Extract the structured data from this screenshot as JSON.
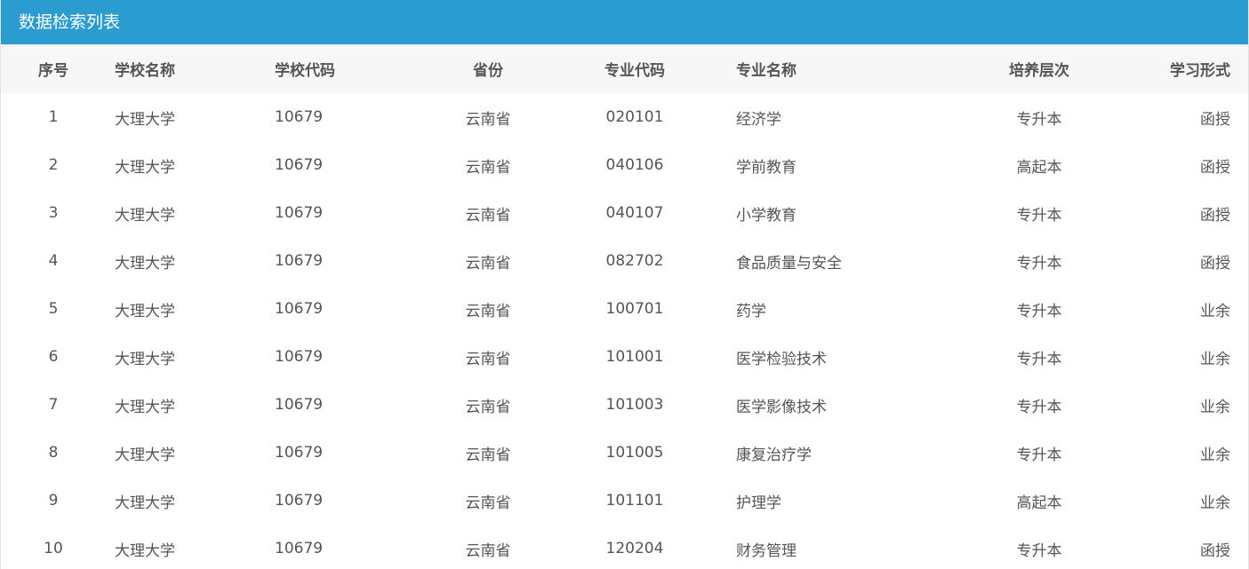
{
  "panel": {
    "title": "数据检索列表"
  },
  "colors": {
    "header_bg": "#2a9ccf",
    "header_text": "#ffffff",
    "thead_bg": "#f7f7f7",
    "text": "#555555"
  },
  "table": {
    "headers": [
      "序号",
      "学校名称",
      "学校代码",
      "省份",
      "专业代码",
      "专业名称",
      "培养层次",
      "学习形式"
    ],
    "rows": [
      [
        "1",
        "大理大学",
        "10679",
        "云南省",
        "020101",
        "经济学",
        "专升本",
        "函授"
      ],
      [
        "2",
        "大理大学",
        "10679",
        "云南省",
        "040106",
        "学前教育",
        "高起本",
        "函授"
      ],
      [
        "3",
        "大理大学",
        "10679",
        "云南省",
        "040107",
        "小学教育",
        "专升本",
        "函授"
      ],
      [
        "4",
        "大理大学",
        "10679",
        "云南省",
        "082702",
        "食品质量与安全",
        "专升本",
        "函授"
      ],
      [
        "5",
        "大理大学",
        "10679",
        "云南省",
        "100701",
        "药学",
        "专升本",
        "业余"
      ],
      [
        "6",
        "大理大学",
        "10679",
        "云南省",
        "101001",
        "医学检验技术",
        "专升本",
        "业余"
      ],
      [
        "7",
        "大理大学",
        "10679",
        "云南省",
        "101003",
        "医学影像技术",
        "专升本",
        "业余"
      ],
      [
        "8",
        "大理大学",
        "10679",
        "云南省",
        "101005",
        "康复治疗学",
        "专升本",
        "业余"
      ],
      [
        "9",
        "大理大学",
        "10679",
        "云南省",
        "101101",
        "护理学",
        "高起本",
        "业余"
      ],
      [
        "10",
        "大理大学",
        "10679",
        "云南省",
        "120204",
        "财务管理",
        "专升本",
        "函授"
      ]
    ]
  }
}
